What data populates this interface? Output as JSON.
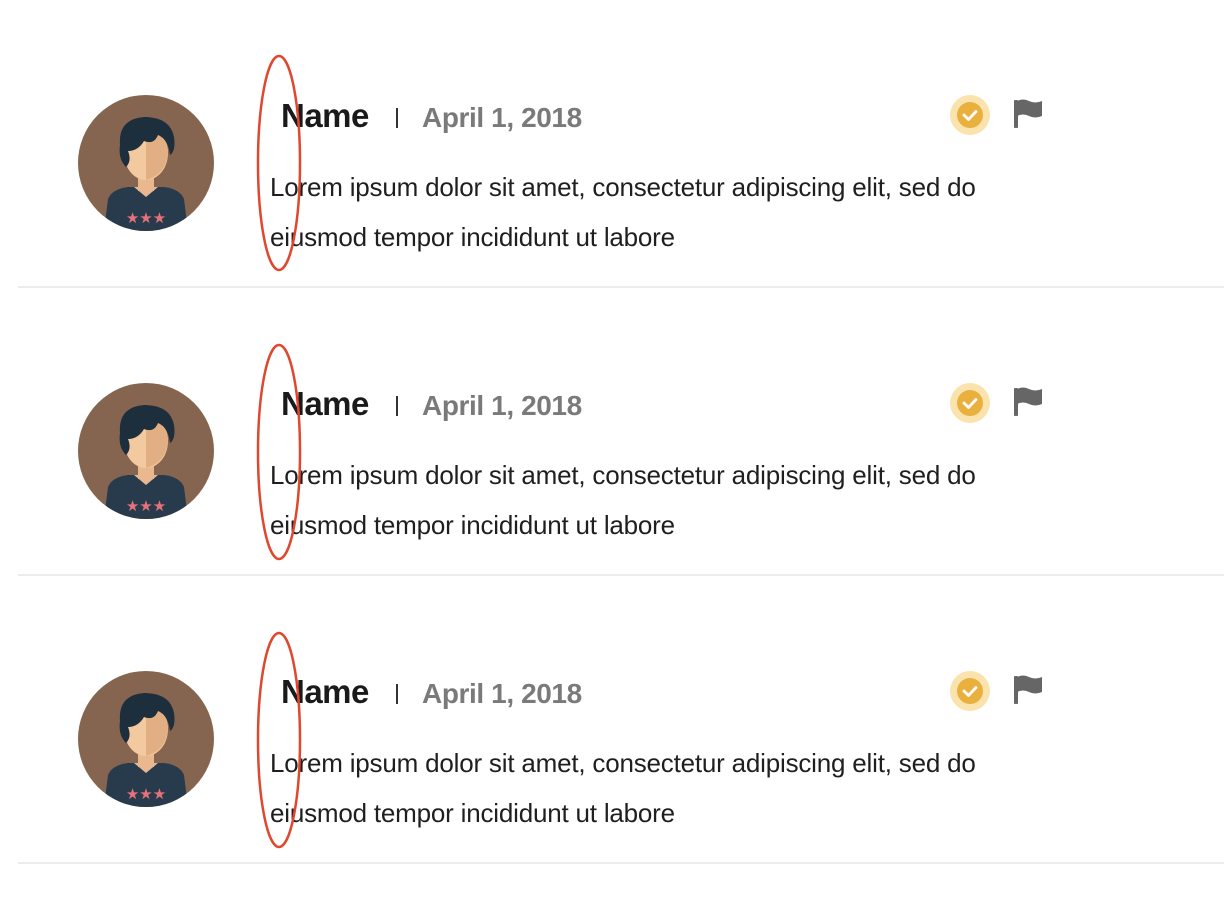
{
  "reviews": [
    {
      "name": "Name",
      "separator": "|",
      "date": "April 1, 2018",
      "text": "Lorem ipsum dolor sit amet, consectetur adipiscing elit, sed do eiusmod tempor incididunt ut labore",
      "verified_icon": "check-circle-icon",
      "flag_icon": "flag-icon"
    },
    {
      "name": "Name",
      "separator": "|",
      "date": "April 1, 2018",
      "text": "Lorem ipsum dolor sit amet, consectetur adipiscing elit, sed do eiusmod tempor incididunt ut labore",
      "verified_icon": "check-circle-icon",
      "flag_icon": "flag-icon"
    },
    {
      "name": "Name",
      "separator": "|",
      "date": "April 1, 2018",
      "text": "Lorem ipsum dolor sit amet, consectetur adipiscing elit, sed do eiusmod tempor incididunt ut labore",
      "verified_icon": "check-circle-icon",
      "flag_icon": "flag-icon"
    }
  ],
  "colors": {
    "avatar_bg": "#85654f",
    "verified_ring": "#fbe3ad",
    "verified_fill": "#eab03e",
    "flag": "#666666",
    "annotation": "#e0482e",
    "date": "#7a7a7a",
    "divider": "#ececec"
  }
}
